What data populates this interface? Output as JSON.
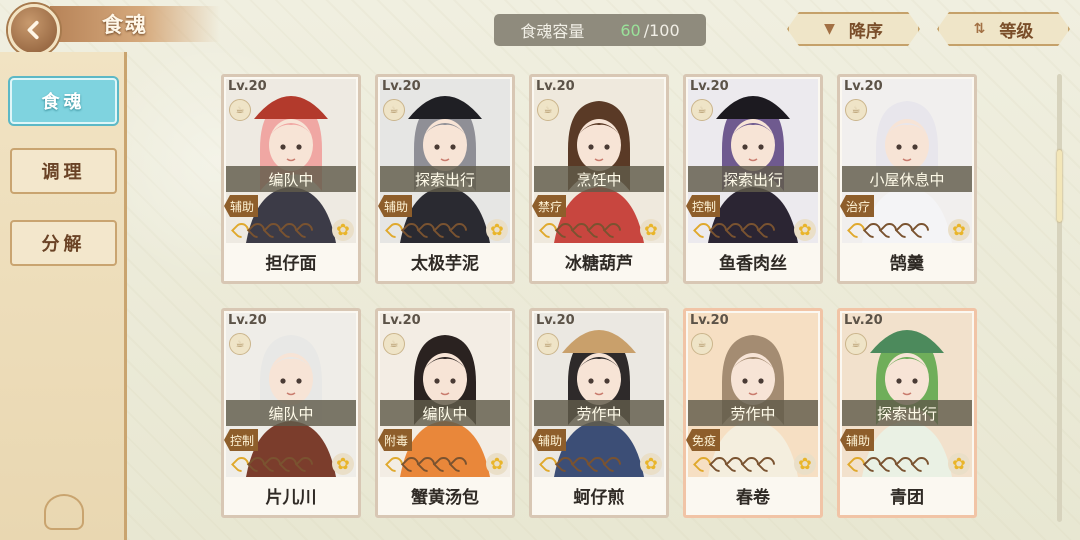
{
  "header": {
    "back_icon": "back-arrow-icon",
    "title": "食魂",
    "capacity_label": "食魂容量",
    "capacity_current": "60",
    "capacity_total": "/100",
    "sort_label": "降序",
    "sort_icon": "triangle-down-icon",
    "level_label": "等级",
    "level_icon": "sort-swap-icon"
  },
  "sidebar": {
    "tabs": [
      {
        "label": "食魂",
        "active": true
      },
      {
        "label": "调理",
        "active": false
      },
      {
        "label": "分解",
        "active": false
      }
    ]
  },
  "colors": {
    "active_tab": "#7fd3df",
    "capacity_current": "#9ae29a",
    "card_border_normal": "#d8c7b4",
    "card_border_gold": "#f1c4a6",
    "role_badge": "#8e5e2b"
  },
  "cards": [
    {
      "level": "Lv.20",
      "status": "编队中",
      "role": "辅助",
      "name": "担仔面",
      "hair": "#f0a7a3",
      "outfit": "#3c3b47",
      "hat": "#b33a2c",
      "bg": "#eeeae2",
      "gold": false
    },
    {
      "level": "Lv.20",
      "status": "探索出行",
      "role": "辅助",
      "name": "太极芋泥",
      "hair": "#8f8f96",
      "outfit": "#2a2a31",
      "hat": "#1f1f24",
      "bg": "#e6e6e4",
      "gold": false
    },
    {
      "level": "Lv.20",
      "status": "烹饪中",
      "role": "禁疗",
      "name": "冰糖葫芦",
      "hair": "#5a3a26",
      "outfit": "#c8463f",
      "hat": "",
      "bg": "#efe9dd",
      "gold": false
    },
    {
      "level": "Lv.20",
      "status": "探索出行",
      "role": "控制",
      "name": "鱼香肉丝",
      "hair": "#6f5a8f",
      "outfit": "#2b2533",
      "hat": "#1c1a20",
      "bg": "#eceaee",
      "gold": false
    },
    {
      "level": "Lv.20",
      "status": "小屋休息中",
      "role": "治疗",
      "name": "鹄羹",
      "hair": "#e8e6ec",
      "outfit": "#f4f4f6",
      "hat": "",
      "bg": "#f1efee",
      "gold": false
    },
    {
      "level": "Lv.20",
      "status": "编队中",
      "role": "控制",
      "name": "片儿川",
      "hair": "#e8e8e6",
      "outfit": "#7b3d2c",
      "hat": "",
      "bg": "#efede8",
      "gold": false
    },
    {
      "level": "Lv.20",
      "status": "编队中",
      "role": "附毒",
      "name": "蟹黄汤包",
      "hair": "#2a2220",
      "outfit": "#e9873a",
      "hat": "",
      "bg": "#f3ede4",
      "gold": false
    },
    {
      "level": "Lv.20",
      "status": "劳作中",
      "role": "辅助",
      "name": "蚵仔煎",
      "hair": "#2e2a2a",
      "outfit": "#3c4e76",
      "hat": "#c9a06b",
      "bg": "#ebe8e2",
      "gold": false
    },
    {
      "level": "Lv.20",
      "status": "劳作中",
      "role": "免疫",
      "name": "春卷",
      "hair": "#a48c72",
      "outfit": "#f4eede",
      "hat": "",
      "bg": "#f6dfc3",
      "gold": true
    },
    {
      "level": "Lv.20",
      "status": "探索出行",
      "role": "辅助",
      "name": "青团",
      "hair": "#6fae5a",
      "outfit": "#eaf1e4",
      "hat": "#4c8a5c",
      "bg": "#f2e1cc",
      "gold": true
    }
  ]
}
